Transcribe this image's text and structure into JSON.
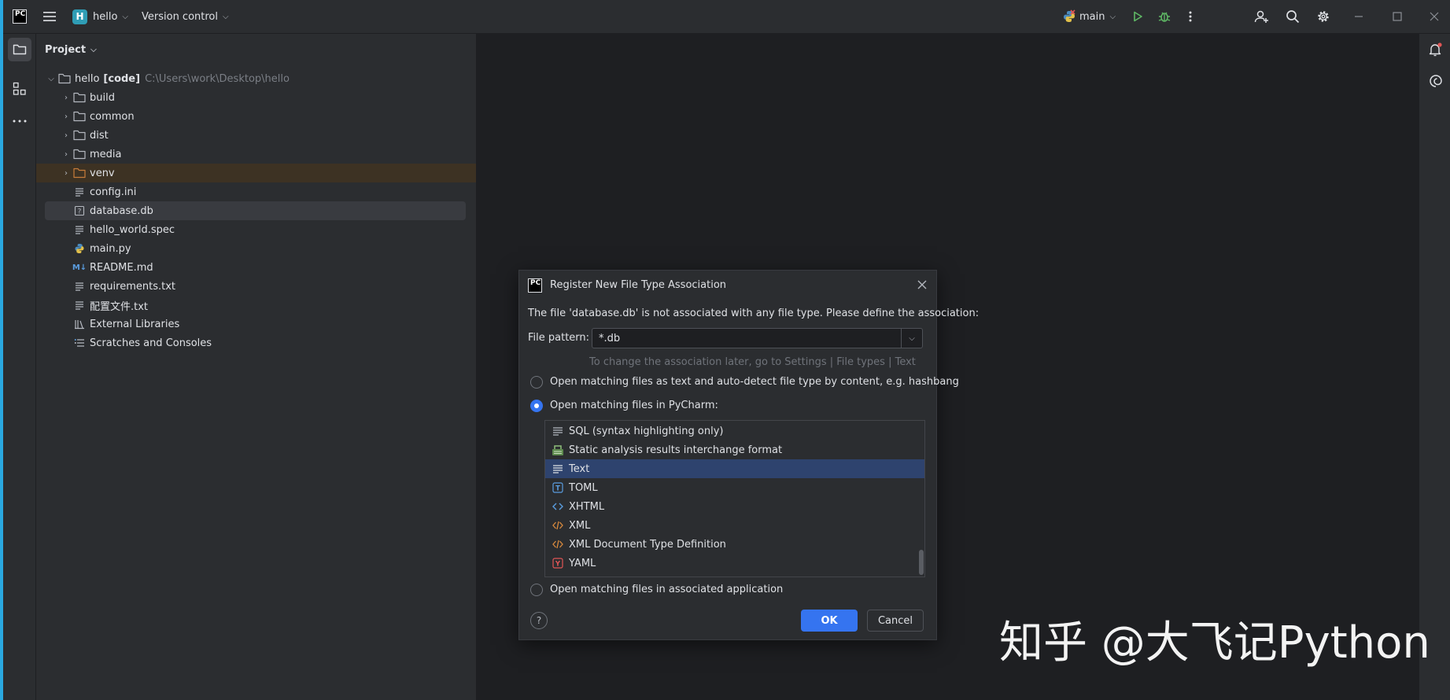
{
  "titlebar": {
    "project_badge": "H",
    "project_name": "hello",
    "vcs_label": "Version control",
    "branch": "main",
    "app_logo": "PC",
    "icons": [
      "hamburger-menu-icon",
      "run-icon",
      "debug-icon",
      "more-vertical-icon",
      "add-user-icon",
      "search-icon",
      "gear-icon",
      "minimize-icon",
      "maximize-icon",
      "close-icon"
    ]
  },
  "panel": {
    "title": "Project",
    "tree": [
      {
        "label": "hello",
        "tag": "[code]",
        "path": "C:\\Users\\work\\Desktop\\hello",
        "icon": "folder-icon"
      },
      {
        "label": "build",
        "icon": "folder-icon"
      },
      {
        "label": "common",
        "icon": "folder-icon"
      },
      {
        "label": "dist",
        "icon": "folder-icon"
      },
      {
        "label": "media",
        "icon": "folder-icon"
      },
      {
        "label": "venv",
        "icon": "folder-orange-icon"
      },
      {
        "label": "config.ini",
        "icon": "text-file-icon"
      },
      {
        "label": "database.db",
        "icon": "unknown-file-icon"
      },
      {
        "label": "hello_world.spec",
        "icon": "text-file-icon"
      },
      {
        "label": "main.py",
        "icon": "python-icon"
      },
      {
        "label": "README.md",
        "icon": "markdown-icon"
      },
      {
        "label": "requirements.txt",
        "icon": "text-file-icon"
      },
      {
        "label": "配置文件.txt",
        "icon": "text-file-icon"
      },
      {
        "label": "External Libraries",
        "icon": "library-icon"
      },
      {
        "label": "Scratches and Consoles",
        "icon": "scratches-icon"
      }
    ]
  },
  "dialog": {
    "title": "Register New File Type Association",
    "message": "The file 'database.db' is not associated with any file type. Please define the association:",
    "pattern_label": "File pattern:",
    "pattern_value": "*.db",
    "hint": "To change the association later, go to Settings | File types | Text",
    "option_text": "Open matching files as text and auto-detect file type by content, e.g. hashbang",
    "option_pycharm": "Open matching files in PyCharm:",
    "option_app": "Open matching files in associated application",
    "file_types": [
      {
        "label": "SQL (syntax highlighting only)",
        "icon": "lines-icon"
      },
      {
        "label": "Static analysis results interchange format",
        "icon": "sarif-icon"
      },
      {
        "label": "Text",
        "icon": "lines-icon"
      },
      {
        "label": "TOML",
        "icon": "toml-icon"
      },
      {
        "label": "XHTML",
        "icon": "xhtml-icon"
      },
      {
        "label": "XML",
        "icon": "xml-icon"
      },
      {
        "label": "XML Document Type Definition",
        "icon": "xml-dtd-icon"
      },
      {
        "label": "YAML",
        "icon": "yaml-icon"
      }
    ],
    "selected_type": "Text",
    "selected_option": "pycharm",
    "ok_label": "OK",
    "cancel_label": "Cancel",
    "help_label": "?"
  },
  "watermark": "知乎 @大飞记Python",
  "colors": {
    "accent": "#3574f0",
    "selection": "#2e436e",
    "venv_highlight": "#3d3223",
    "folder_orange": "#c77c3a"
  }
}
